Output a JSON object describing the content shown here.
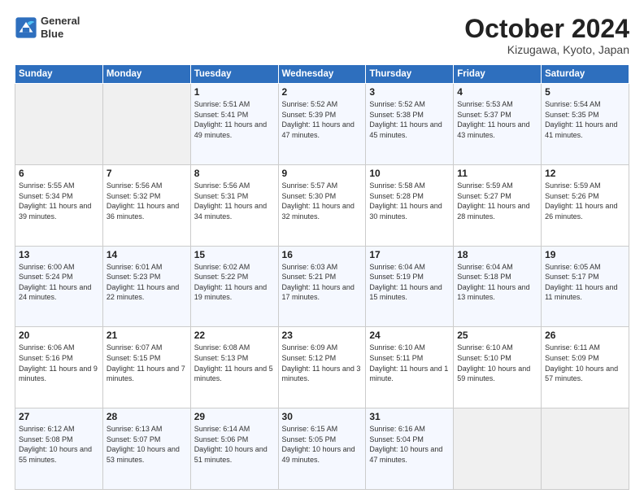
{
  "header": {
    "logo_line1": "General",
    "logo_line2": "Blue",
    "month": "October 2024",
    "location": "Kizugawa, Kyoto, Japan"
  },
  "weekdays": [
    "Sunday",
    "Monday",
    "Tuesday",
    "Wednesday",
    "Thursday",
    "Friday",
    "Saturday"
  ],
  "weeks": [
    [
      {
        "day": "",
        "info": ""
      },
      {
        "day": "",
        "info": ""
      },
      {
        "day": "1",
        "info": "Sunrise: 5:51 AM\nSunset: 5:41 PM\nDaylight: 11 hours and 49 minutes."
      },
      {
        "day": "2",
        "info": "Sunrise: 5:52 AM\nSunset: 5:39 PM\nDaylight: 11 hours and 47 minutes."
      },
      {
        "day": "3",
        "info": "Sunrise: 5:52 AM\nSunset: 5:38 PM\nDaylight: 11 hours and 45 minutes."
      },
      {
        "day": "4",
        "info": "Sunrise: 5:53 AM\nSunset: 5:37 PM\nDaylight: 11 hours and 43 minutes."
      },
      {
        "day": "5",
        "info": "Sunrise: 5:54 AM\nSunset: 5:35 PM\nDaylight: 11 hours and 41 minutes."
      }
    ],
    [
      {
        "day": "6",
        "info": "Sunrise: 5:55 AM\nSunset: 5:34 PM\nDaylight: 11 hours and 39 minutes."
      },
      {
        "day": "7",
        "info": "Sunrise: 5:56 AM\nSunset: 5:32 PM\nDaylight: 11 hours and 36 minutes."
      },
      {
        "day": "8",
        "info": "Sunrise: 5:56 AM\nSunset: 5:31 PM\nDaylight: 11 hours and 34 minutes."
      },
      {
        "day": "9",
        "info": "Sunrise: 5:57 AM\nSunset: 5:30 PM\nDaylight: 11 hours and 32 minutes."
      },
      {
        "day": "10",
        "info": "Sunrise: 5:58 AM\nSunset: 5:28 PM\nDaylight: 11 hours and 30 minutes."
      },
      {
        "day": "11",
        "info": "Sunrise: 5:59 AM\nSunset: 5:27 PM\nDaylight: 11 hours and 28 minutes."
      },
      {
        "day": "12",
        "info": "Sunrise: 5:59 AM\nSunset: 5:26 PM\nDaylight: 11 hours and 26 minutes."
      }
    ],
    [
      {
        "day": "13",
        "info": "Sunrise: 6:00 AM\nSunset: 5:24 PM\nDaylight: 11 hours and 24 minutes."
      },
      {
        "day": "14",
        "info": "Sunrise: 6:01 AM\nSunset: 5:23 PM\nDaylight: 11 hours and 22 minutes."
      },
      {
        "day": "15",
        "info": "Sunrise: 6:02 AM\nSunset: 5:22 PM\nDaylight: 11 hours and 19 minutes."
      },
      {
        "day": "16",
        "info": "Sunrise: 6:03 AM\nSunset: 5:21 PM\nDaylight: 11 hours and 17 minutes."
      },
      {
        "day": "17",
        "info": "Sunrise: 6:04 AM\nSunset: 5:19 PM\nDaylight: 11 hours and 15 minutes."
      },
      {
        "day": "18",
        "info": "Sunrise: 6:04 AM\nSunset: 5:18 PM\nDaylight: 11 hours and 13 minutes."
      },
      {
        "day": "19",
        "info": "Sunrise: 6:05 AM\nSunset: 5:17 PM\nDaylight: 11 hours and 11 minutes."
      }
    ],
    [
      {
        "day": "20",
        "info": "Sunrise: 6:06 AM\nSunset: 5:16 PM\nDaylight: 11 hours and 9 minutes."
      },
      {
        "day": "21",
        "info": "Sunrise: 6:07 AM\nSunset: 5:15 PM\nDaylight: 11 hours and 7 minutes."
      },
      {
        "day": "22",
        "info": "Sunrise: 6:08 AM\nSunset: 5:13 PM\nDaylight: 11 hours and 5 minutes."
      },
      {
        "day": "23",
        "info": "Sunrise: 6:09 AM\nSunset: 5:12 PM\nDaylight: 11 hours and 3 minutes."
      },
      {
        "day": "24",
        "info": "Sunrise: 6:10 AM\nSunset: 5:11 PM\nDaylight: 11 hours and 1 minute."
      },
      {
        "day": "25",
        "info": "Sunrise: 6:10 AM\nSunset: 5:10 PM\nDaylight: 10 hours and 59 minutes."
      },
      {
        "day": "26",
        "info": "Sunrise: 6:11 AM\nSunset: 5:09 PM\nDaylight: 10 hours and 57 minutes."
      }
    ],
    [
      {
        "day": "27",
        "info": "Sunrise: 6:12 AM\nSunset: 5:08 PM\nDaylight: 10 hours and 55 minutes."
      },
      {
        "day": "28",
        "info": "Sunrise: 6:13 AM\nSunset: 5:07 PM\nDaylight: 10 hours and 53 minutes."
      },
      {
        "day": "29",
        "info": "Sunrise: 6:14 AM\nSunset: 5:06 PM\nDaylight: 10 hours and 51 minutes."
      },
      {
        "day": "30",
        "info": "Sunrise: 6:15 AM\nSunset: 5:05 PM\nDaylight: 10 hours and 49 minutes."
      },
      {
        "day": "31",
        "info": "Sunrise: 6:16 AM\nSunset: 5:04 PM\nDaylight: 10 hours and 47 minutes."
      },
      {
        "day": "",
        "info": ""
      },
      {
        "day": "",
        "info": ""
      }
    ]
  ]
}
